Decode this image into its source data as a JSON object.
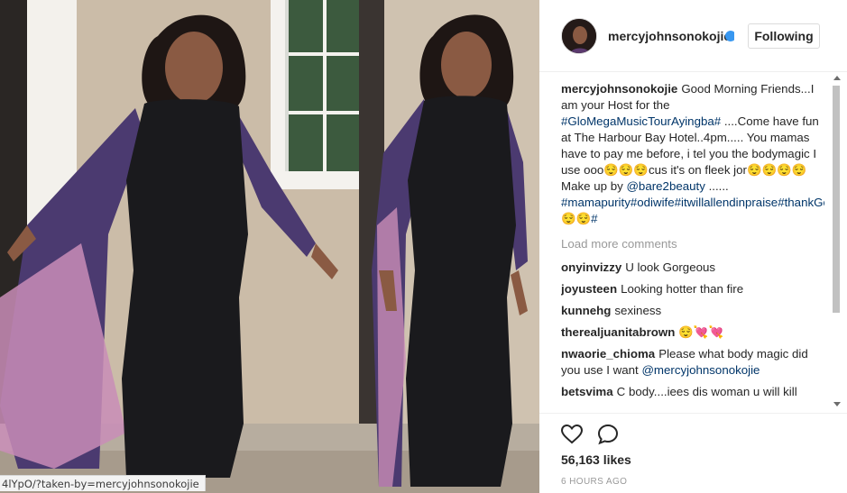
{
  "photo": {
    "alt": "",
    "status_url": "4lYpO/?taken-by=mercyjohnsonokojie"
  },
  "post": {
    "username": "mercyjohnsonokojie",
    "follow_label": "Following",
    "caption": {
      "username": "mercyjohnsonokojie",
      "segments": [
        {
          "text": "Good Morning Friends...I am your Host for the ",
          "type": "text"
        },
        {
          "text": "#GloMegaMusicTourAyingba#",
          "type": "tag"
        },
        {
          "text": " ....Come have fun at The Harbour Bay Hotel..4pm..... You mamas have to pay me before, i tel you the bodymagic I use ooo😌😌😌cus it's on fleek jor😌😌😌😌 Make up by ",
          "type": "text"
        },
        {
          "text": "@bare2beauty",
          "type": "tag"
        },
        {
          "text": " ...... ",
          "type": "text"
        },
        {
          "text": "#mamapurity#odiwife#itwillallendinpraise#thankGodformakeupsha😌😌#",
          "type": "tag"
        }
      ]
    },
    "load_more_label": "Load more comments",
    "comments": [
      {
        "user": "onyinvizzy",
        "text": "U look Gorgeous"
      },
      {
        "user": "joyusteen",
        "text": "Looking hotter than fire"
      },
      {
        "user": "kunnehg",
        "text": "sexiness"
      },
      {
        "user": "therealjuanitabrown",
        "text": "😌💘💘"
      },
      {
        "user": "nwaorie_chioma",
        "text": "Please what body magic did you use I want ",
        "mention": "@mercyjohnsonokojie"
      },
      {
        "user": "betsvima",
        "text": "C body....iees dis woman u will kill"
      }
    ],
    "likes": "56,163 likes",
    "time_ago": "6 HOURS AGO"
  },
  "icons": {
    "like": "heart-outline-icon",
    "comment": "speech-bubble-icon",
    "verified": "verified-badge-icon"
  },
  "colors": {
    "link": "#003569",
    "verified": "#3897f0",
    "muted": "#999999"
  }
}
